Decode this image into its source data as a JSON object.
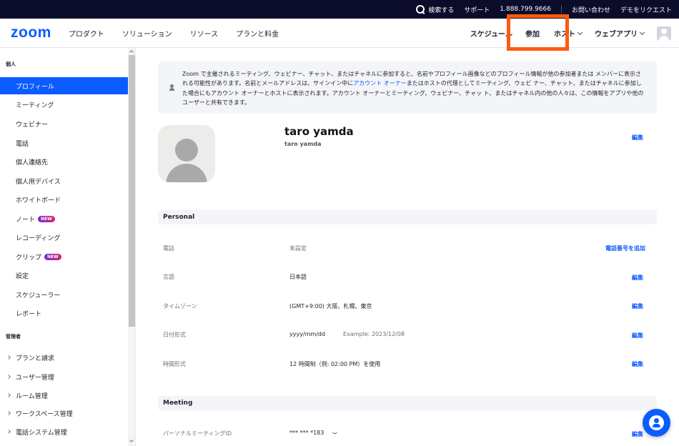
{
  "topbar": {
    "search_label": "検索する",
    "support": "サポート",
    "phone": "1.888.799.9666",
    "contact": "お問い合わせ",
    "demo": "デモをリクエスト"
  },
  "nav": {
    "logo": "zoom",
    "left": [
      "プロダクト",
      "ソリューション",
      "リソース",
      "プランと料金"
    ],
    "schedule": "スケジュール",
    "join": "参加",
    "host": "ホスト",
    "web_app": "ウェブアプリ"
  },
  "sidebar": {
    "personal_section": "個人",
    "items": [
      {
        "label": "プロフィール",
        "badge": ""
      },
      {
        "label": "ミーティング",
        "badge": ""
      },
      {
        "label": "ウェビナー",
        "badge": ""
      },
      {
        "label": "電話",
        "badge": ""
      },
      {
        "label": "個人連絡先",
        "badge": ""
      },
      {
        "label": "個人用デバイス",
        "badge": ""
      },
      {
        "label": "ホワイトボード",
        "badge": ""
      },
      {
        "label": "ノート",
        "badge": "NEW"
      },
      {
        "label": "レコーディング",
        "badge": ""
      },
      {
        "label": "クリップ",
        "badge": "NEW"
      },
      {
        "label": "設定",
        "badge": ""
      },
      {
        "label": "スケジューラー",
        "badge": ""
      },
      {
        "label": "レポート",
        "badge": ""
      }
    ],
    "admin_section": "管理者",
    "admin_items": [
      "プランと請求",
      "ユーザー管理",
      "ルーム管理",
      "ワークスペース管理",
      "電話システム管理"
    ]
  },
  "notice": {
    "text_before": "Zoom で主催されるミーティング、ウェビナー、チャット、またはチャネルに参加すると、名前やプロフィール画像などのプロフィール情報が他の参加者または メンバーに表示される可能性があります。名前とメールアドレスは、サインイン中に",
    "link": "アカウント オーナー",
    "text_after": "またはホストの代理としてミーティング、ウェビ ナー、チャット、またはチャネルに参加した場合にもアカウント オーナーとホストに表示されます。アカウント オーナーとミーティング、ウェビナー、チャッ ト、またはチャネル内の他の人々は、この情報をアプリや他のユーザーと共有できます。"
  },
  "profile": {
    "display_name": "taro yamda",
    "sub_name": "taro yamda",
    "edit": "編集"
  },
  "personal": {
    "header": "Personal",
    "phone_label": "電話",
    "phone_value": "未設定",
    "phone_action": "電話番号を追加",
    "language_label": "言語",
    "language_value": "日本語",
    "timezone_label": "タイムゾーン",
    "timezone_value": "(GMT+9:00) 大阪、札幌、東京",
    "date_label": "日付形式",
    "date_value": "yyyy/mm/dd",
    "date_example": "Example: 2023/12/08",
    "time_label": "時間形式",
    "time_value": "12 時間制（例: 02:00 PM）を使用",
    "edit": "編集"
  },
  "meeting": {
    "header": "Meeting",
    "pmi_label": "パーソナルミーティングID",
    "pmi_value": "*** *** *183",
    "edit": "編集"
  },
  "colors": {
    "accent": "#0b5cff",
    "topbar": "#0b0b2a",
    "highlight": "#ff5a0f"
  }
}
